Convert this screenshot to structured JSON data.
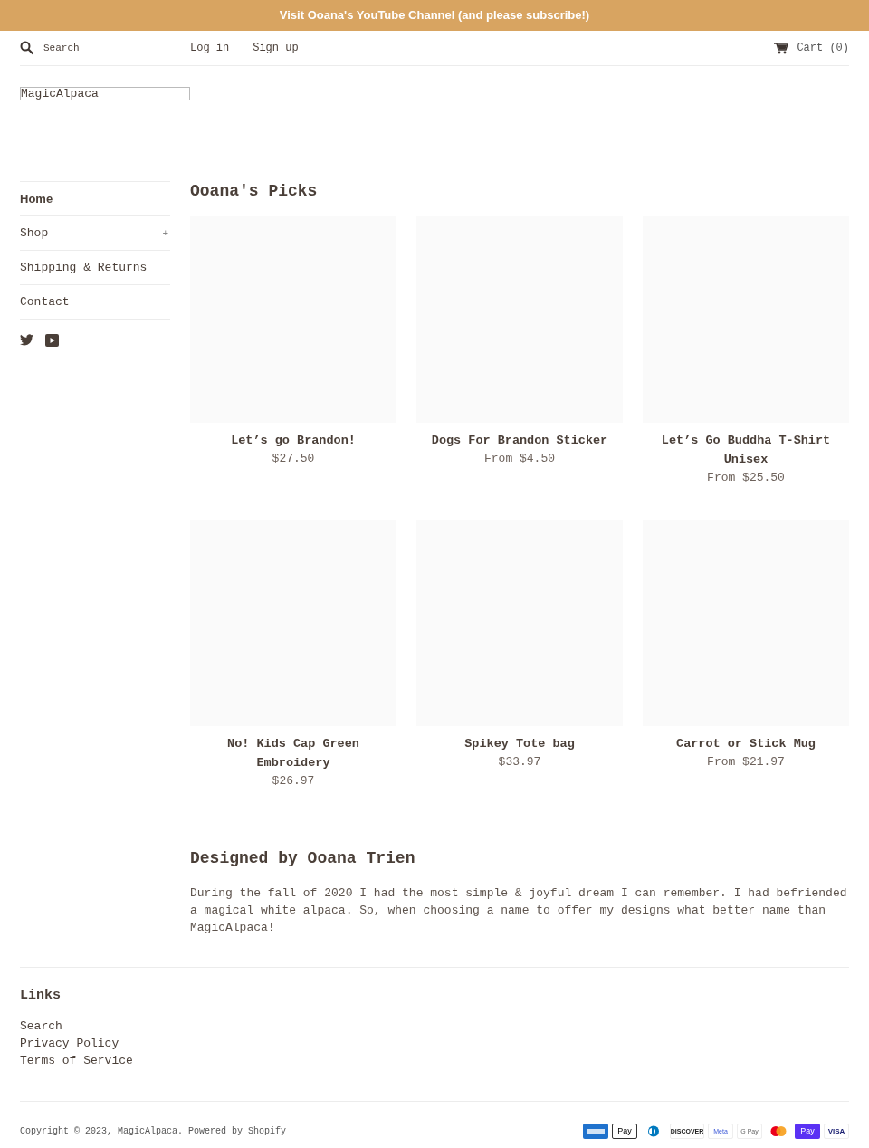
{
  "announcement": "Visit Ooana's YouTube Channel (and please subscribe!)",
  "header": {
    "search_placeholder": "Search",
    "links": [
      "Log in",
      "Sign up"
    ],
    "cart": "Cart (0)"
  },
  "logo": "MagicAlpaca",
  "sidebar": {
    "items": [
      {
        "label": "Home",
        "selected": true,
        "expandable": false
      },
      {
        "label": "Shop",
        "selected": false,
        "expandable": true,
        "toggle": "+"
      },
      {
        "label": "Shipping & Returns",
        "selected": false,
        "expandable": false
      },
      {
        "label": "Contact",
        "selected": false,
        "expandable": false
      }
    ],
    "social": [
      {
        "kind": "twitter"
      },
      {
        "kind": "youtube"
      }
    ]
  },
  "collection": {
    "title": "Ooana's Picks",
    "products": [
      {
        "title": "Let’s go Brandon!",
        "price": "$27.50"
      },
      {
        "title": "Dogs For Brandon Sticker",
        "price": "From $4.50"
      },
      {
        "title": "Let’s Go Buddha T-Shirt Unisex",
        "price": "From $25.50"
      },
      {
        "title": "No! Kids Cap Green Embroidery",
        "price": "$26.97"
      },
      {
        "title": "Spikey Tote bag",
        "price": "$33.97"
      },
      {
        "title": "Carrot or Stick Mug",
        "price": "From $21.97"
      }
    ]
  },
  "about": {
    "title": "Designed by Ooana Trien",
    "text": "During the fall of 2020 I had the most simple & joyful dream I can remember. I had befriended a magical white alpaca. So, when choosing a name to offer my designs what better name than MagicAlpaca!"
  },
  "footer": {
    "links_title": "Links",
    "links": [
      "Search",
      "Privacy Policy",
      "Terms of Service"
    ],
    "copyright": "Copyright © 2023, MagicAlpaca. Powered by Shopify",
    "payments": [
      {
        "kind": "amex"
      },
      {
        "kind": "applepay",
        "label": "Pay"
      },
      {
        "kind": "diners"
      },
      {
        "kind": "discover",
        "label": "DISCOVER"
      },
      {
        "kind": "meta",
        "label": "Meta"
      },
      {
        "kind": "gpay",
        "label": "G Pay"
      },
      {
        "kind": "mastercard"
      },
      {
        "kind": "shoppay",
        "label": "Pay"
      },
      {
        "kind": "visa",
        "label": "VISA"
      }
    ]
  }
}
